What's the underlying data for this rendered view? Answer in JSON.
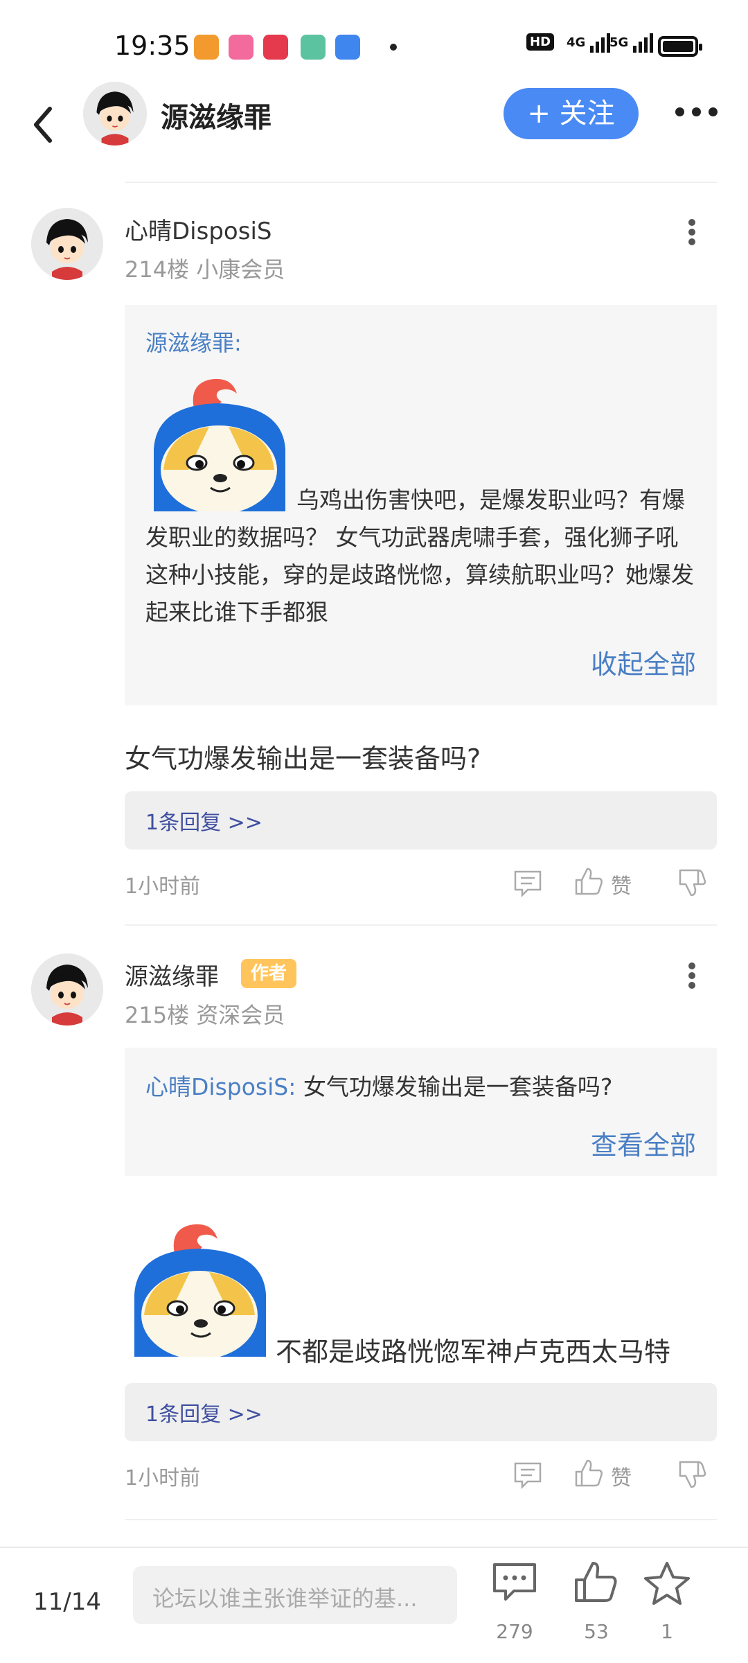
{
  "status_bar": {
    "time": "19:35",
    "network_labels": [
      "HD",
      "4G",
      "5G"
    ],
    "app_icons": [
      "uc-browser-icon",
      "bilibili-icon",
      "app-store-icon",
      "notes-icon",
      "multitask-icon"
    ]
  },
  "header": {
    "title": "源滋缘罪",
    "follow_label": "+ 关注"
  },
  "posts": [
    {
      "username": "心晴DisposiS",
      "meta": "214楼 小康会员",
      "quote_name": "源滋缘罪:",
      "quote_text": "乌鸡出伤害快吧，是爆发职业吗？有爆发职业的数据吗？ 女气功武器虎啸手套，强化狮子吼这种小技能，穿的是歧路恍惚，算续航职业吗？她爆发起来比谁下手都狠",
      "expand_label": "收起全部",
      "comment": "女气功爆发输出是一套装备吗?",
      "reply_link": "1条回复 >>",
      "time_ago": "1小时前",
      "like_label": "赞"
    },
    {
      "username": "源滋缘罪",
      "badge": "作者",
      "meta": "215楼 资深会员",
      "quote_name": "心晴DisposiS:",
      "quote_text": "女气功爆发输出是一套装备吗?",
      "expand_label": "查看全部",
      "comment": "不都是歧路恍惚军神卢克西太马特",
      "reply_link": "1条回复 >>",
      "time_ago": "1小时前",
      "like_label": "赞"
    }
  ],
  "bottom_bar": {
    "page_indicator": "11/14",
    "input_placeholder": "论坛以谁主张谁举证的基...",
    "comment_count": "279",
    "like_count": "53",
    "star_count": "1"
  },
  "colors": {
    "accent": "#4a8af4",
    "link": "#4a7fc4",
    "badge": "#ffc55c",
    "reply_link": "#3f4fa0"
  }
}
